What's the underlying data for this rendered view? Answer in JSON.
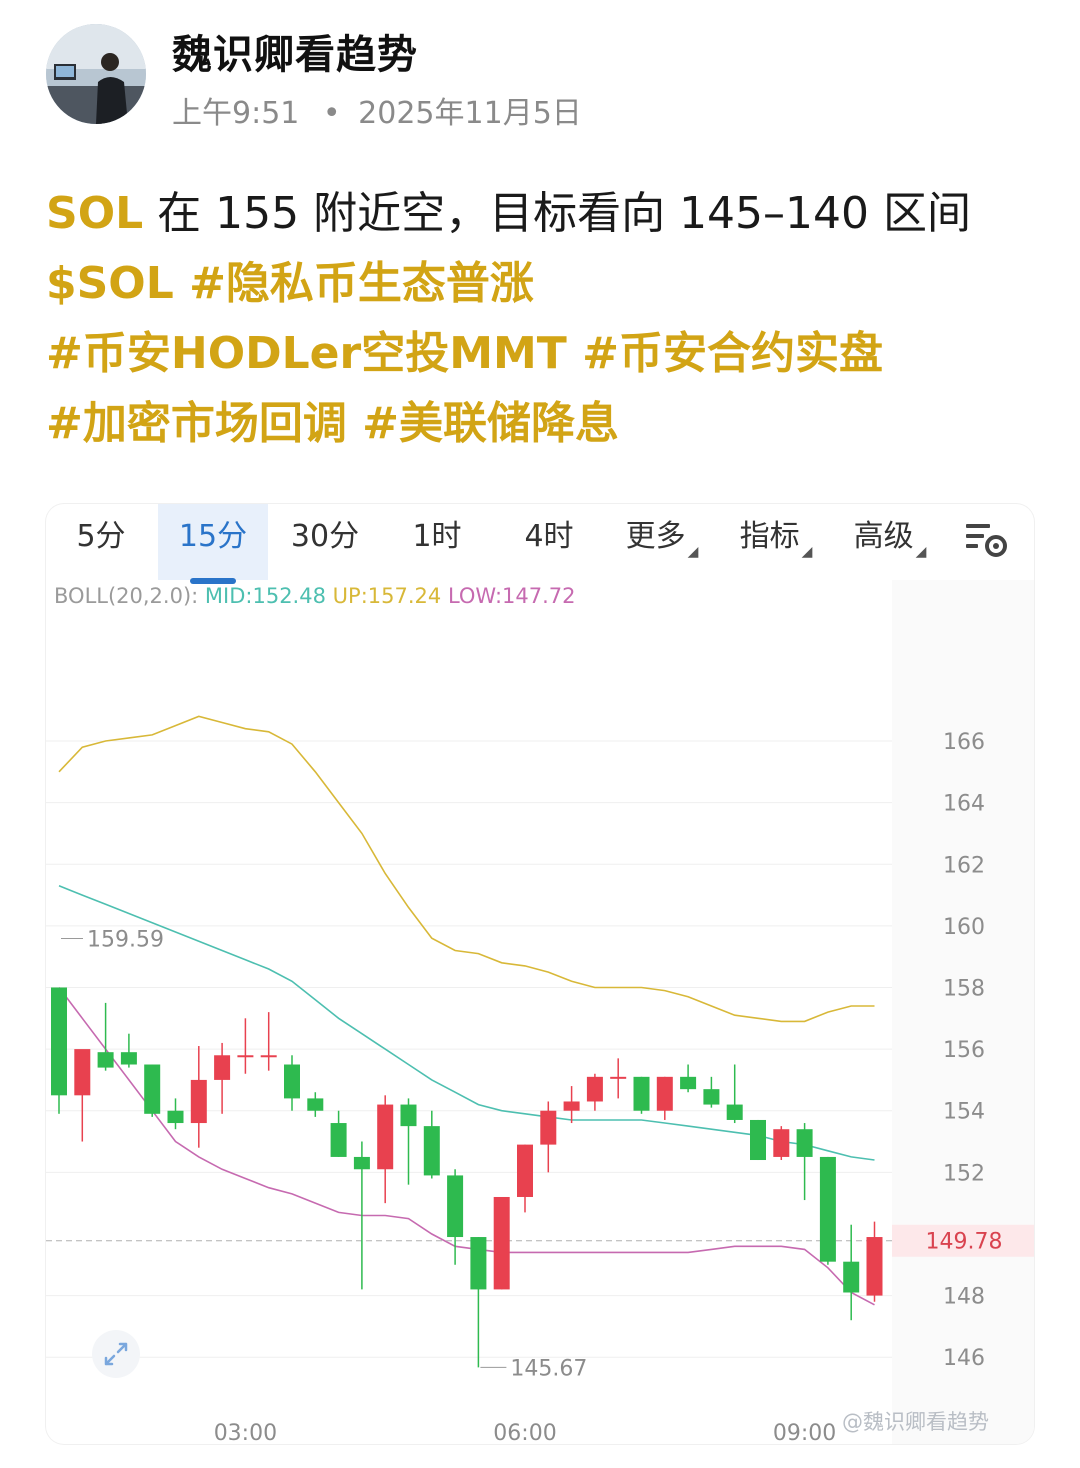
{
  "post": {
    "author": "魏识卿看趋势",
    "time": "上午9:51",
    "separator": "•",
    "date": "2025年11月5日",
    "text_symbol": "SOL",
    "text_body": " 在 155 附近空，目标看向 145–140 区间",
    "tag_line_1": "$SOL #隐私币生态普涨",
    "tag_line_2": "#币安HODLer空投MMT #币安合约实盘",
    "tag_line_3": "#加密市场回调 #美联储降息"
  },
  "toolbar": {
    "tabs": [
      {
        "label": "5分",
        "active": false
      },
      {
        "label": "15分",
        "active": true
      },
      {
        "label": "30分",
        "active": false
      },
      {
        "label": "1时",
        "active": false
      },
      {
        "label": "4时",
        "active": false
      },
      {
        "label": "更多",
        "active": false
      },
      {
        "label": "指标",
        "active": false
      },
      {
        "label": "高级",
        "active": false
      }
    ],
    "settings_icon": "settings-list-icon"
  },
  "indicator": {
    "name": "BOLL(20,2.0):",
    "mid": "MID:152.48",
    "up": "UP:157.24",
    "low": "LOW:147.72"
  },
  "watermark": "@魏识卿看趋势",
  "colors": {
    "accent_tag": "#d2a415",
    "tab_active": "#2a74c9",
    "candle_up": "#e8414f",
    "candle_down": "#2eba4f",
    "boll_up": "#d8b838",
    "boll_mid": "#4dbfb0",
    "boll_low": "#c66ab0"
  },
  "chart_data": {
    "type": "candlestick",
    "interval": "15分",
    "y_ticks": [
      166,
      164,
      162,
      160,
      158,
      156,
      154,
      152,
      148,
      146
    ],
    "ylim": [
      145.0,
      168.5
    ],
    "x_ticks": [
      {
        "label": "03:00",
        "index": 8
      },
      {
        "label": "06:00",
        "index": 20
      },
      {
        "label": "09:00",
        "index": 32
      }
    ],
    "current_price": "149.78",
    "high_marker": {
      "label": "159.59",
      "index": 0,
      "value": 159.59
    },
    "low_marker": {
      "label": "145.67",
      "index": 18,
      "value": 145.67
    },
    "candles": [
      {
        "o": 158.0,
        "h": 158.0,
        "l": 153.9,
        "c": 154.5
      },
      {
        "o": 154.5,
        "h": 155.3,
        "l": 153.0,
        "c": 156.0
      },
      {
        "o": 155.9,
        "h": 157.5,
        "l": 155.3,
        "c": 155.4
      },
      {
        "o": 155.9,
        "h": 156.5,
        "l": 155.4,
        "c": 155.5
      },
      {
        "o": 155.5,
        "h": 155.5,
        "l": 153.8,
        "c": 153.9
      },
      {
        "o": 154.0,
        "h": 154.4,
        "l": 153.4,
        "c": 153.6
      },
      {
        "o": 153.6,
        "h": 156.1,
        "l": 152.8,
        "c": 155.0
      },
      {
        "o": 155.0,
        "h": 156.2,
        "l": 153.9,
        "c": 155.8
      },
      {
        "o": 155.8,
        "h": 157.0,
        "l": 155.2,
        "c": 155.8
      },
      {
        "o": 155.8,
        "h": 157.2,
        "l": 155.3,
        "c": 155.8
      },
      {
        "o": 155.5,
        "h": 155.8,
        "l": 154.0,
        "c": 154.4
      },
      {
        "o": 154.4,
        "h": 154.6,
        "l": 153.8,
        "c": 154.0
      },
      {
        "o": 153.6,
        "h": 154.0,
        "l": 152.5,
        "c": 152.5
      },
      {
        "o": 152.5,
        "h": 153.0,
        "l": 148.2,
        "c": 152.1
      },
      {
        "o": 152.1,
        "h": 154.5,
        "l": 151.0,
        "c": 154.2
      },
      {
        "o": 154.2,
        "h": 154.4,
        "l": 151.6,
        "c": 153.5
      },
      {
        "o": 153.5,
        "h": 154.0,
        "l": 151.8,
        "c": 151.9
      },
      {
        "o": 151.9,
        "h": 152.1,
        "l": 149.0,
        "c": 149.9
      },
      {
        "o": 149.9,
        "h": 149.9,
        "l": 145.67,
        "c": 148.2
      },
      {
        "o": 148.2,
        "h": 151.2,
        "l": 148.2,
        "c": 151.2
      },
      {
        "o": 151.2,
        "h": 152.9,
        "l": 150.7,
        "c": 152.9
      },
      {
        "o": 152.9,
        "h": 154.3,
        "l": 152.0,
        "c": 154.0
      },
      {
        "o": 154.0,
        "h": 154.8,
        "l": 153.6,
        "c": 154.3
      },
      {
        "o": 154.3,
        "h": 155.2,
        "l": 154.0,
        "c": 155.1
      },
      {
        "o": 155.1,
        "h": 155.7,
        "l": 154.4,
        "c": 155.1
      },
      {
        "o": 155.1,
        "h": 155.1,
        "l": 153.9,
        "c": 154.0
      },
      {
        "o": 154.0,
        "h": 155.1,
        "l": 153.7,
        "c": 155.1
      },
      {
        "o": 155.1,
        "h": 155.5,
        "l": 154.6,
        "c": 154.7
      },
      {
        "o": 154.7,
        "h": 155.1,
        "l": 154.1,
        "c": 154.2
      },
      {
        "o": 154.2,
        "h": 155.5,
        "l": 153.6,
        "c": 153.7
      },
      {
        "o": 153.7,
        "h": 153.7,
        "l": 152.4,
        "c": 152.4
      },
      {
        "o": 152.5,
        "h": 153.5,
        "l": 152.4,
        "c": 153.4
      },
      {
        "o": 153.4,
        "h": 153.6,
        "l": 151.1,
        "c": 152.5
      },
      {
        "o": 152.5,
        "h": 152.5,
        "l": 149.0,
        "c": 149.1
      },
      {
        "o": 149.1,
        "h": 150.3,
        "l": 147.2,
        "c": 148.1
      },
      {
        "o": 148.0,
        "h": 150.4,
        "l": 147.8,
        "c": 149.9
      }
    ],
    "boll_upper": [
      165.0,
      165.8,
      166.0,
      166.1,
      166.2,
      166.5,
      166.8,
      166.6,
      166.4,
      166.3,
      165.9,
      165.0,
      164.0,
      163.0,
      161.7,
      160.6,
      159.6,
      159.2,
      159.1,
      158.8,
      158.7,
      158.5,
      158.2,
      158.0,
      158.0,
      158.0,
      157.9,
      157.7,
      157.4,
      157.1,
      157.0,
      156.9,
      156.9,
      157.2,
      157.4,
      157.4
    ],
    "boll_mid": [
      161.3,
      161.0,
      160.7,
      160.4,
      160.1,
      159.8,
      159.5,
      159.2,
      158.9,
      158.6,
      158.2,
      157.6,
      157.0,
      156.5,
      156.0,
      155.5,
      155.0,
      154.6,
      154.2,
      154.0,
      153.9,
      153.8,
      153.7,
      153.7,
      153.7,
      153.7,
      153.6,
      153.5,
      153.4,
      153.3,
      153.2,
      153.0,
      152.9,
      152.7,
      152.5,
      152.4
    ],
    "boll_lower": [
      158.0,
      157.0,
      156.0,
      155.0,
      154.0,
      153.0,
      152.5,
      152.1,
      151.8,
      151.5,
      151.3,
      151.0,
      150.7,
      150.6,
      150.6,
      150.5,
      150.0,
      149.6,
      149.5,
      149.4,
      149.4,
      149.4,
      149.4,
      149.4,
      149.4,
      149.4,
      149.4,
      149.4,
      149.5,
      149.6,
      149.6,
      149.6,
      149.5,
      148.9,
      148.1,
      147.7
    ]
  }
}
